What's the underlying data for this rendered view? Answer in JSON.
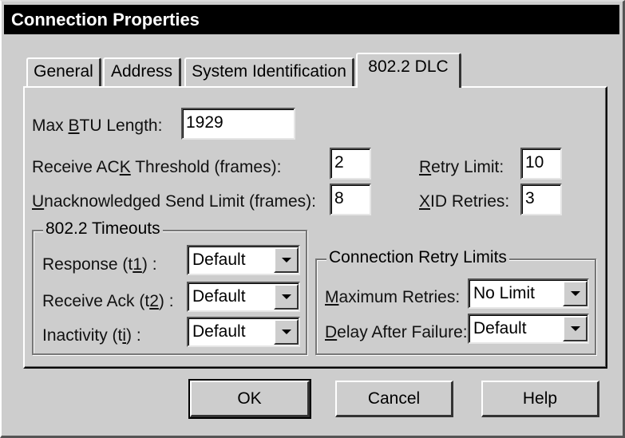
{
  "window": {
    "title": "Connection Properties"
  },
  "tabs": [
    {
      "label": "General"
    },
    {
      "label": "Address"
    },
    {
      "label": "System Identification"
    },
    {
      "label": "802.2 DLC",
      "active": true
    }
  ],
  "fields": {
    "max_btu": {
      "label_pre": "Max ",
      "label_u": "B",
      "label_post": "TU Length:",
      "value": "1929"
    },
    "receive_ack_threshold": {
      "label_pre": "Receive AC",
      "label_u": "K",
      "label_post": " Threshold (frames):",
      "value": "2"
    },
    "unack_send_limit": {
      "label_pre": "",
      "label_u": "U",
      "label_post": "nacknowledged Send Limit (frames):",
      "value": "8"
    },
    "retry_limit": {
      "label_pre": "",
      "label_u": "R",
      "label_post": "etry Limit:",
      "value": "10"
    },
    "xid_retries": {
      "label_pre": "",
      "label_u": "X",
      "label_post": "ID Retries:",
      "value": "3"
    }
  },
  "timeouts": {
    "title": "802.2 Timeouts",
    "response": {
      "label_pre": "Response (t",
      "label_u": "1",
      "label_post": ") :",
      "value": "Default"
    },
    "receive_ack": {
      "label_pre": "Receive Ack (t",
      "label_u": "2",
      "label_post": ") :",
      "value": "Default"
    },
    "inactivity": {
      "label_pre": "Inactivity (t",
      "label_u": "i",
      "label_post": ") :",
      "value": "Default"
    }
  },
  "retry_limits": {
    "title": "Connection Retry Limits",
    "maximum_retries": {
      "label_pre": "",
      "label_u": "M",
      "label_post": "aximum Retries:",
      "value": "No Limit"
    },
    "delay_after_failure": {
      "label_pre": "",
      "label_u": "D",
      "label_post": "elay After Failure:",
      "value": "Default"
    }
  },
  "buttons": {
    "ok": "OK",
    "cancel": "Cancel",
    "help": "Help"
  }
}
